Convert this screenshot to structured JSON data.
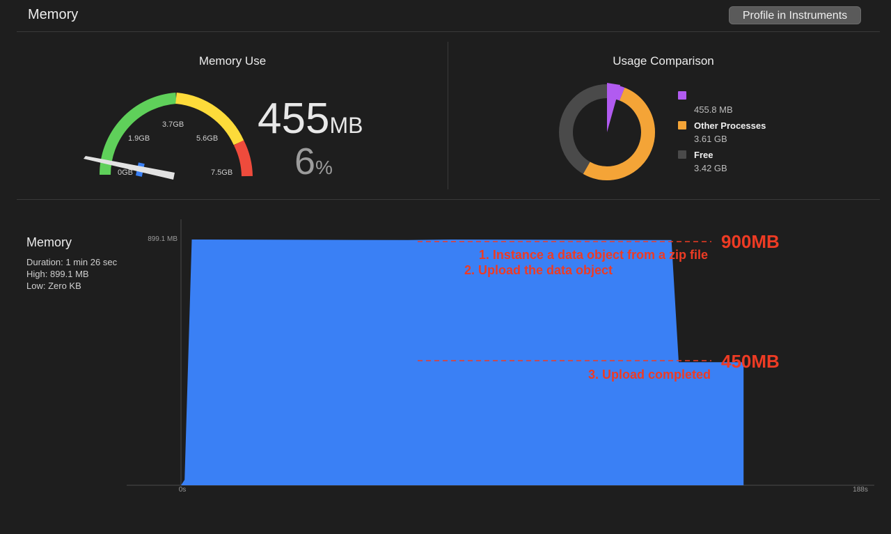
{
  "header": {
    "title": "Memory",
    "profile_button": "Profile in Instruments"
  },
  "memory_use": {
    "title": "Memory Use",
    "value": "455",
    "unit": "MB",
    "percent": "6",
    "percent_unit": "%",
    "gauge_ticks": [
      "0GB",
      "1.9GB",
      "3.7GB",
      "5.6GB",
      "7.5GB"
    ],
    "gauge_colors": {
      "green": "#5fd05a",
      "yellow": "#fddb3a",
      "red": "#ef4b3c"
    },
    "gauge_fraction": 0.06
  },
  "usage_comparison": {
    "title": "Usage Comparison",
    "legend": [
      {
        "label": "",
        "value": "455.8 MB",
        "color": "#b15bf0"
      },
      {
        "label": "Other Processes",
        "value": "3.61 GB",
        "color": "#f4a437"
      },
      {
        "label": "Free",
        "value": "3.42 GB",
        "color": "#4a4a4a"
      }
    ]
  },
  "timeline": {
    "title": "Memory",
    "stats": [
      "Duration: 1 min 26 sec",
      "High: 899.1 MB",
      "Low: Zero KB"
    ]
  },
  "chart_data": {
    "type": "area",
    "y_max_label": "899.1 MB",
    "x_start_label": "0s",
    "x_end_label": "188s",
    "xlim": [
      0,
      188
    ],
    "ylim": [
      0,
      899.1
    ],
    "color": "#3a80f5",
    "points": [
      {
        "x": 0,
        "y": 0
      },
      {
        "x": 1,
        "y": 20
      },
      {
        "x": 3,
        "y": 899.1
      },
      {
        "x": 63,
        "y": 897
      },
      {
        "x": 75,
        "y": 899.1
      },
      {
        "x": 136,
        "y": 897
      },
      {
        "x": 138,
        "y": 450
      },
      {
        "x": 156,
        "y": 450
      },
      {
        "x": 156,
        "y": 0
      }
    ]
  },
  "annotations": {
    "top_value": "900MB",
    "top_lines": [
      "1. Instance a data object from a zip file",
      "2. Upload the data object"
    ],
    "bottom_value": "450MB",
    "bottom_lines": [
      "3. Upload completed"
    ],
    "color": "#ee3b24"
  }
}
